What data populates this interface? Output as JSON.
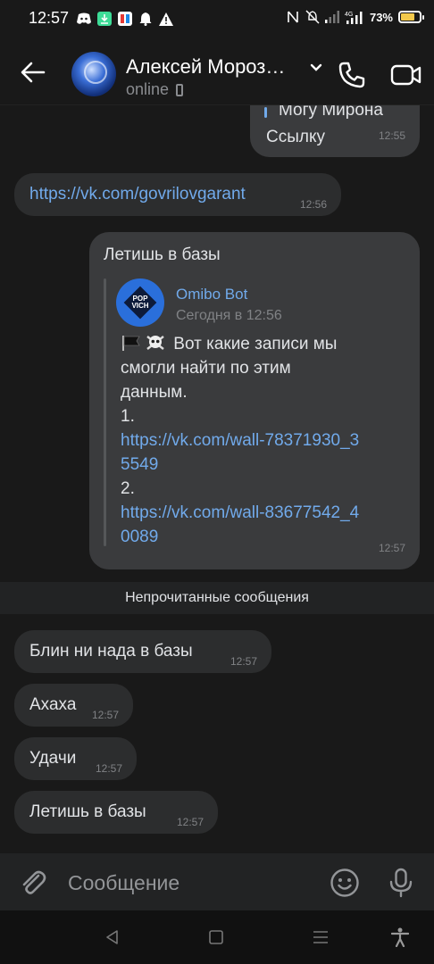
{
  "status_bar": {
    "time": "12:57",
    "network": "4G",
    "battery": "73%",
    "battery_level": 0.73
  },
  "header": {
    "contact_name": "Алексей Мороз…",
    "status": "online",
    "icons": [
      "back-arrow-icon",
      "avatar",
      "chevron-down-icon",
      "phone-icon",
      "video-call-icon"
    ]
  },
  "messages": {
    "m1": {
      "quote": "Могу Мирона",
      "text": "Ссылку",
      "time": "12:55"
    },
    "m2": {
      "text": "https://vk.com/govrilovgarant",
      "time": "12:56"
    },
    "m3": {
      "text": "Летишь в базы",
      "time": "12:57",
      "forward": {
        "author": "Omibo Bot",
        "avatar_text": "POP VICH",
        "date": "Сегодня в 12:56",
        "lines": [
          "Вот какие записи мы",
          "смогли найти по этим",
          "данным.",
          "1.",
          "https://vk.com/wall-78371930_3",
          "5549",
          "2.",
          "https://vk.com/wall-83677542_4",
          "0089"
        ]
      }
    },
    "unread_divider": "Непрочитанные сообщения",
    "m4": {
      "text": "Блин ни нада в базы",
      "time": "12:57"
    },
    "m5": {
      "text": "Ахаха",
      "time": "12:57"
    },
    "m6": {
      "text": "Удачи",
      "time": "12:57"
    },
    "m7": {
      "text": "Летишь в базы",
      "time": "12:57"
    }
  },
  "composer": {
    "placeholder": "Сообщение",
    "icons": [
      "paperclip-icon",
      "emoji-icon",
      "microphone-icon"
    ]
  },
  "colors": {
    "background": "#191919",
    "bubble_in": "#2c2d2e",
    "bubble_out": "#3a3b3d",
    "link": "#71aaeb",
    "battery": "#f2c94c"
  }
}
